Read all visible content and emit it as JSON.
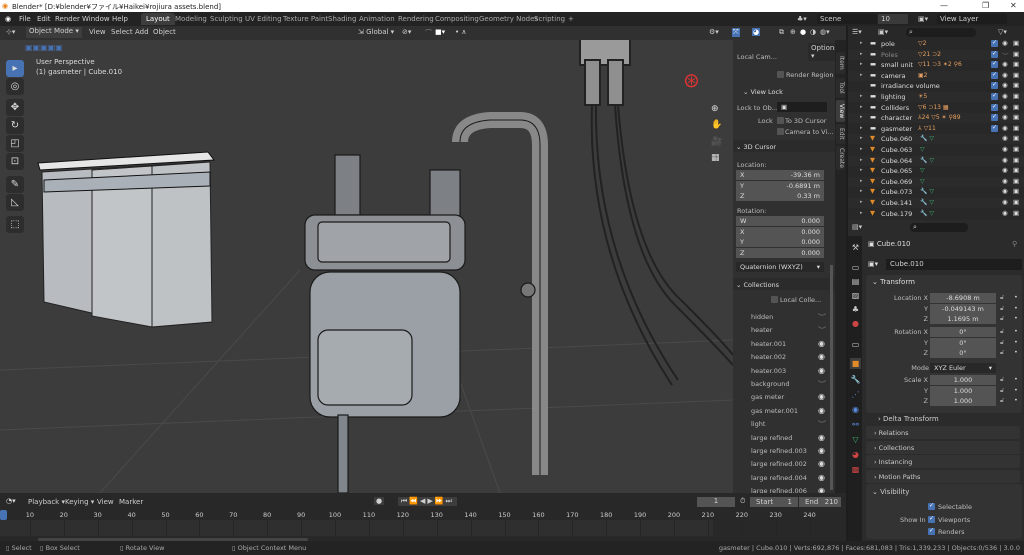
{
  "window": {
    "title": "Blender* [D:¥blender¥ファイル¥Haikei¥rojiura assets.blend]",
    "minimize": "—",
    "maximize": "❐",
    "close": "✕"
  },
  "menu": [
    "File",
    "Edit",
    "Render",
    "Window",
    "Help"
  ],
  "workspaces": [
    "Layout",
    "Modeling",
    "Sculpting",
    "UV Editing",
    "Texture Paint",
    "Shading",
    "Animation",
    "Rendering",
    "Compositing",
    "Geometry Nodes",
    "Scripting",
    "+"
  ],
  "scene": {
    "label": "Scene",
    "number": "10",
    "view_layer": "View Layer"
  },
  "vp_header": {
    "mode": "Object Mode",
    "view": "View",
    "select": "Select",
    "add": "Add",
    "object": "Object",
    "orientation": "Global",
    "options": "Options"
  },
  "viewport": {
    "perspective": "User Perspective",
    "object_info": "(1) gasmeter | Cube.010"
  },
  "npanel": {
    "tabs": [
      "Item",
      "Tool",
      "View",
      "Edit",
      "Create"
    ],
    "local_camera": "Local Cam...",
    "render_region": "Render Region",
    "view_lock": "View Lock",
    "lock_to_object": "Lock to Ob...",
    "lock": "Lock",
    "to_3d_cursor": "To 3D Cursor",
    "camera_to_view": "Camera to Vi...",
    "cursor_title": "3D Cursor",
    "location": "Location:",
    "loc": [
      {
        "axis": "X",
        "value": "-39.36 m"
      },
      {
        "axis": "Y",
        "value": "-0.6891 m"
      },
      {
        "axis": "Z",
        "value": "0.33 m"
      }
    ],
    "rotation": "Rotation:",
    "rot": [
      {
        "axis": "W",
        "value": "0.000"
      },
      {
        "axis": "X",
        "value": "0.000"
      },
      {
        "axis": "Y",
        "value": "0.000"
      },
      {
        "axis": "Z",
        "value": "0.000"
      }
    ],
    "rotation_mode": "Quaternion (WXYZ)",
    "collections_title": "Collections",
    "local_collections": "Local Colle...",
    "collections": [
      {
        "name": "hidden",
        "visible": false
      },
      {
        "name": "heater",
        "visible": false
      },
      {
        "name": "heater.001",
        "visible": true
      },
      {
        "name": "heater.002",
        "visible": true
      },
      {
        "name": "heater.003",
        "visible": true
      },
      {
        "name": "background",
        "visible": false
      },
      {
        "name": "gas meter",
        "visible": true
      },
      {
        "name": "gas meter.001",
        "visible": true
      },
      {
        "name": "light",
        "visible": false
      },
      {
        "name": "large refined",
        "visible": true
      },
      {
        "name": "large refined.003",
        "visible": true
      },
      {
        "name": "large refined.002",
        "visible": true
      },
      {
        "name": "large refined.004",
        "visible": true
      },
      {
        "name": "large refined.006",
        "visible": true
      }
    ]
  },
  "outliner": {
    "rows": [
      {
        "name": "pole",
        "type": "collection",
        "badges": "▽2",
        "checked": true,
        "eye": true
      },
      {
        "name": "Poles",
        "type": "collection",
        "badges": "▽21 ⊃2",
        "checked": true,
        "eye": false
      },
      {
        "name": "small unit",
        "type": "collection",
        "badges": "▽11 ⊃3 ✶2 ⚲6",
        "checked": true,
        "eye": true
      },
      {
        "name": "camera",
        "type": "collection",
        "badges": "▣2",
        "checked": true,
        "eye": true
      },
      {
        "name": "irradiance volume",
        "type": "collection",
        "badges": "",
        "checked": true,
        "eye": true
      },
      {
        "name": "lighting",
        "type": "collection",
        "badges": "☀5",
        "checked": true,
        "eye": true
      },
      {
        "name": "Colliders",
        "type": "collection",
        "badges": "▽6 ⊃13 ▦",
        "checked": true,
        "eye": true
      },
      {
        "name": "character",
        "type": "collection",
        "badges": "⅄24 ▽5 ✶ ⚲89",
        "checked": true,
        "eye": true
      },
      {
        "name": "gasmeter",
        "type": "collection",
        "badges": "⅄ ▽11",
        "checked": true,
        "eye": true
      },
      {
        "name": "Cube.060",
        "type": "mesh",
        "badges": "🔧 ▽",
        "checked": false,
        "eye": true
      },
      {
        "name": "Cube.063",
        "type": "mesh",
        "badges": "▽",
        "checked": false,
        "eye": true
      },
      {
        "name": "Cube.064",
        "type": "mesh",
        "badges": "🔧 ▽",
        "checked": false,
        "eye": true
      },
      {
        "name": "Cube.065",
        "type": "mesh",
        "badges": "▽",
        "checked": false,
        "eye": true
      },
      {
        "name": "Cube.069",
        "type": "mesh",
        "badges": "▽",
        "checked": false,
        "eye": true
      },
      {
        "name": "Cube.073",
        "type": "mesh",
        "badges": "🔧 ▽",
        "checked": false,
        "eye": true
      },
      {
        "name": "Cube.141",
        "type": "mesh",
        "badges": "🔧 ▽",
        "checked": false,
        "eye": true
      },
      {
        "name": "Cube.179",
        "type": "mesh",
        "badges": "🔧 ▽",
        "checked": false,
        "eye": true
      }
    ]
  },
  "properties": {
    "object_name": "Cube.010",
    "object_field": "Cube.010",
    "transform": "Transform",
    "location": [
      {
        "label": "Location X",
        "value": "-8.6908 m"
      },
      {
        "label": "Y",
        "value": "-0.049143 m"
      },
      {
        "label": "Z",
        "value": "1.1695 m"
      }
    ],
    "rotation": [
      {
        "label": "Rotation X",
        "value": "0°"
      },
      {
        "label": "Y",
        "value": "0°"
      },
      {
        "label": "Z",
        "value": "0°"
      }
    ],
    "mode_label": "Mode",
    "mode": "XYZ Euler",
    "scale": [
      {
        "label": "Scale X",
        "value": "1.000"
      },
      {
        "label": "Y",
        "value": "1.000"
      },
      {
        "label": "Z",
        "value": "1.000"
      }
    ],
    "delta_transform": "Delta Transform",
    "sections": [
      "Relations",
      "Collections",
      "Instancing",
      "Motion Paths"
    ],
    "visibility": "Visibility",
    "selectable": "Selectable",
    "show_in": "Show In",
    "viewports": "Viewports",
    "renders": "Renders"
  },
  "timeline": {
    "playback": "Playback",
    "keying": "Keying",
    "view": "View",
    "marker": "Marker",
    "current_frame": "1",
    "start_label": "Start",
    "start": "1",
    "end_label": "End",
    "end": "210",
    "ticks": [
      10,
      20,
      30,
      40,
      50,
      60,
      70,
      80,
      90,
      100,
      110,
      120,
      130,
      140,
      150,
      160,
      170,
      180,
      190,
      200,
      210,
      220,
      230,
      240
    ]
  },
  "status": {
    "select": "Select",
    "box_select": "Box Select",
    "rotate_view": "Rotate View",
    "context_menu": "Object Context Menu",
    "stats": "gasmeter | Cube.010 | Verts:692,876 | Faces:681,083 | Tris:1,339,233 | Objects:0/536 | 3.0.0"
  },
  "colors": {
    "accent": "#4772b3",
    "collection_icon": "#e8a060",
    "mesh_icon": "#e08a2a",
    "viewport_bg": "#3c3c3c"
  }
}
